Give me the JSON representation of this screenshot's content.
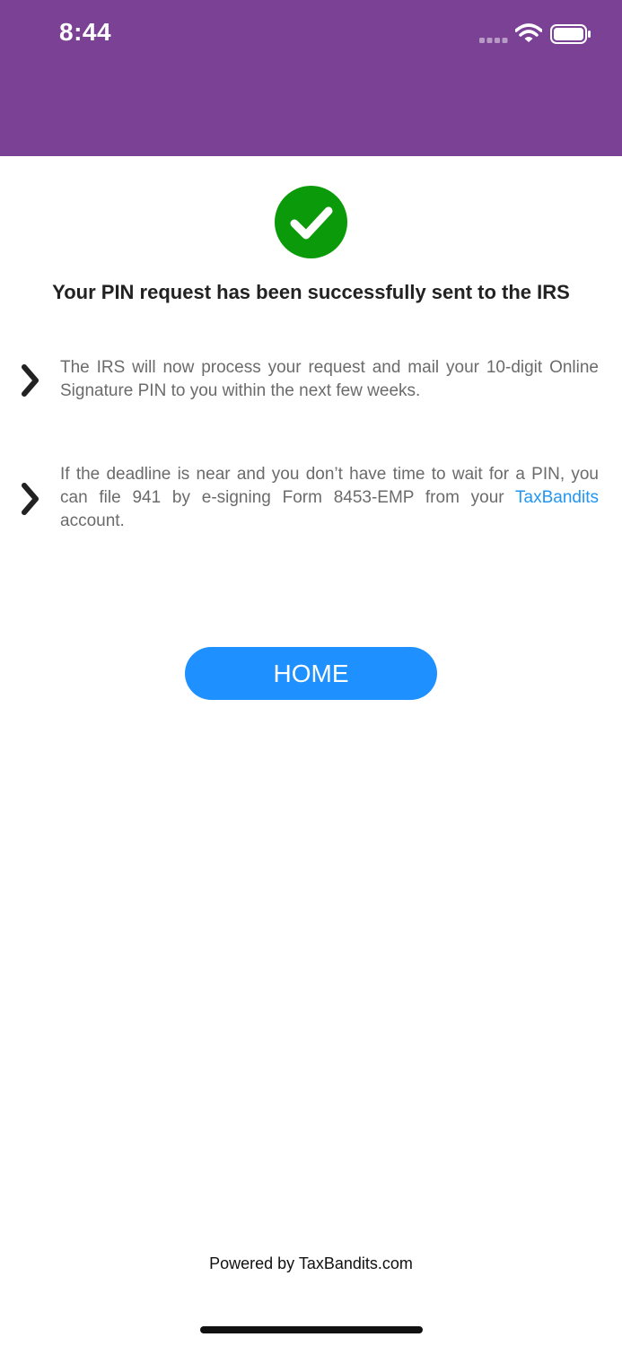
{
  "status_bar": {
    "time": "8:44",
    "signal_icon": "signal-dots-icon",
    "wifi_icon": "wifi-icon",
    "battery_icon": "battery-icon"
  },
  "colors": {
    "header": "#7b4195",
    "success": "#0a9a0a",
    "button": "#1e90ff",
    "link": "#2196f3",
    "body_text": "#6b6b6b"
  },
  "success": {
    "icon": "checkmark-circle-icon",
    "title": "Your PIN request has been successfully sent to the IRS"
  },
  "info_items": [
    {
      "text": "The IRS will now process your request and mail your 10-digit Online Signature PIN to you within the next few weeks."
    },
    {
      "text_before": "If the deadline is near and you don’t have time to wait for a PIN, you can file 941 by e-signing Form 8453-EMP from your ",
      "link": "TaxBandits",
      "text_after": " account."
    }
  ],
  "home_button": {
    "label": "HOME"
  },
  "footer": {
    "powered_by": "Powered by TaxBandits.com"
  }
}
